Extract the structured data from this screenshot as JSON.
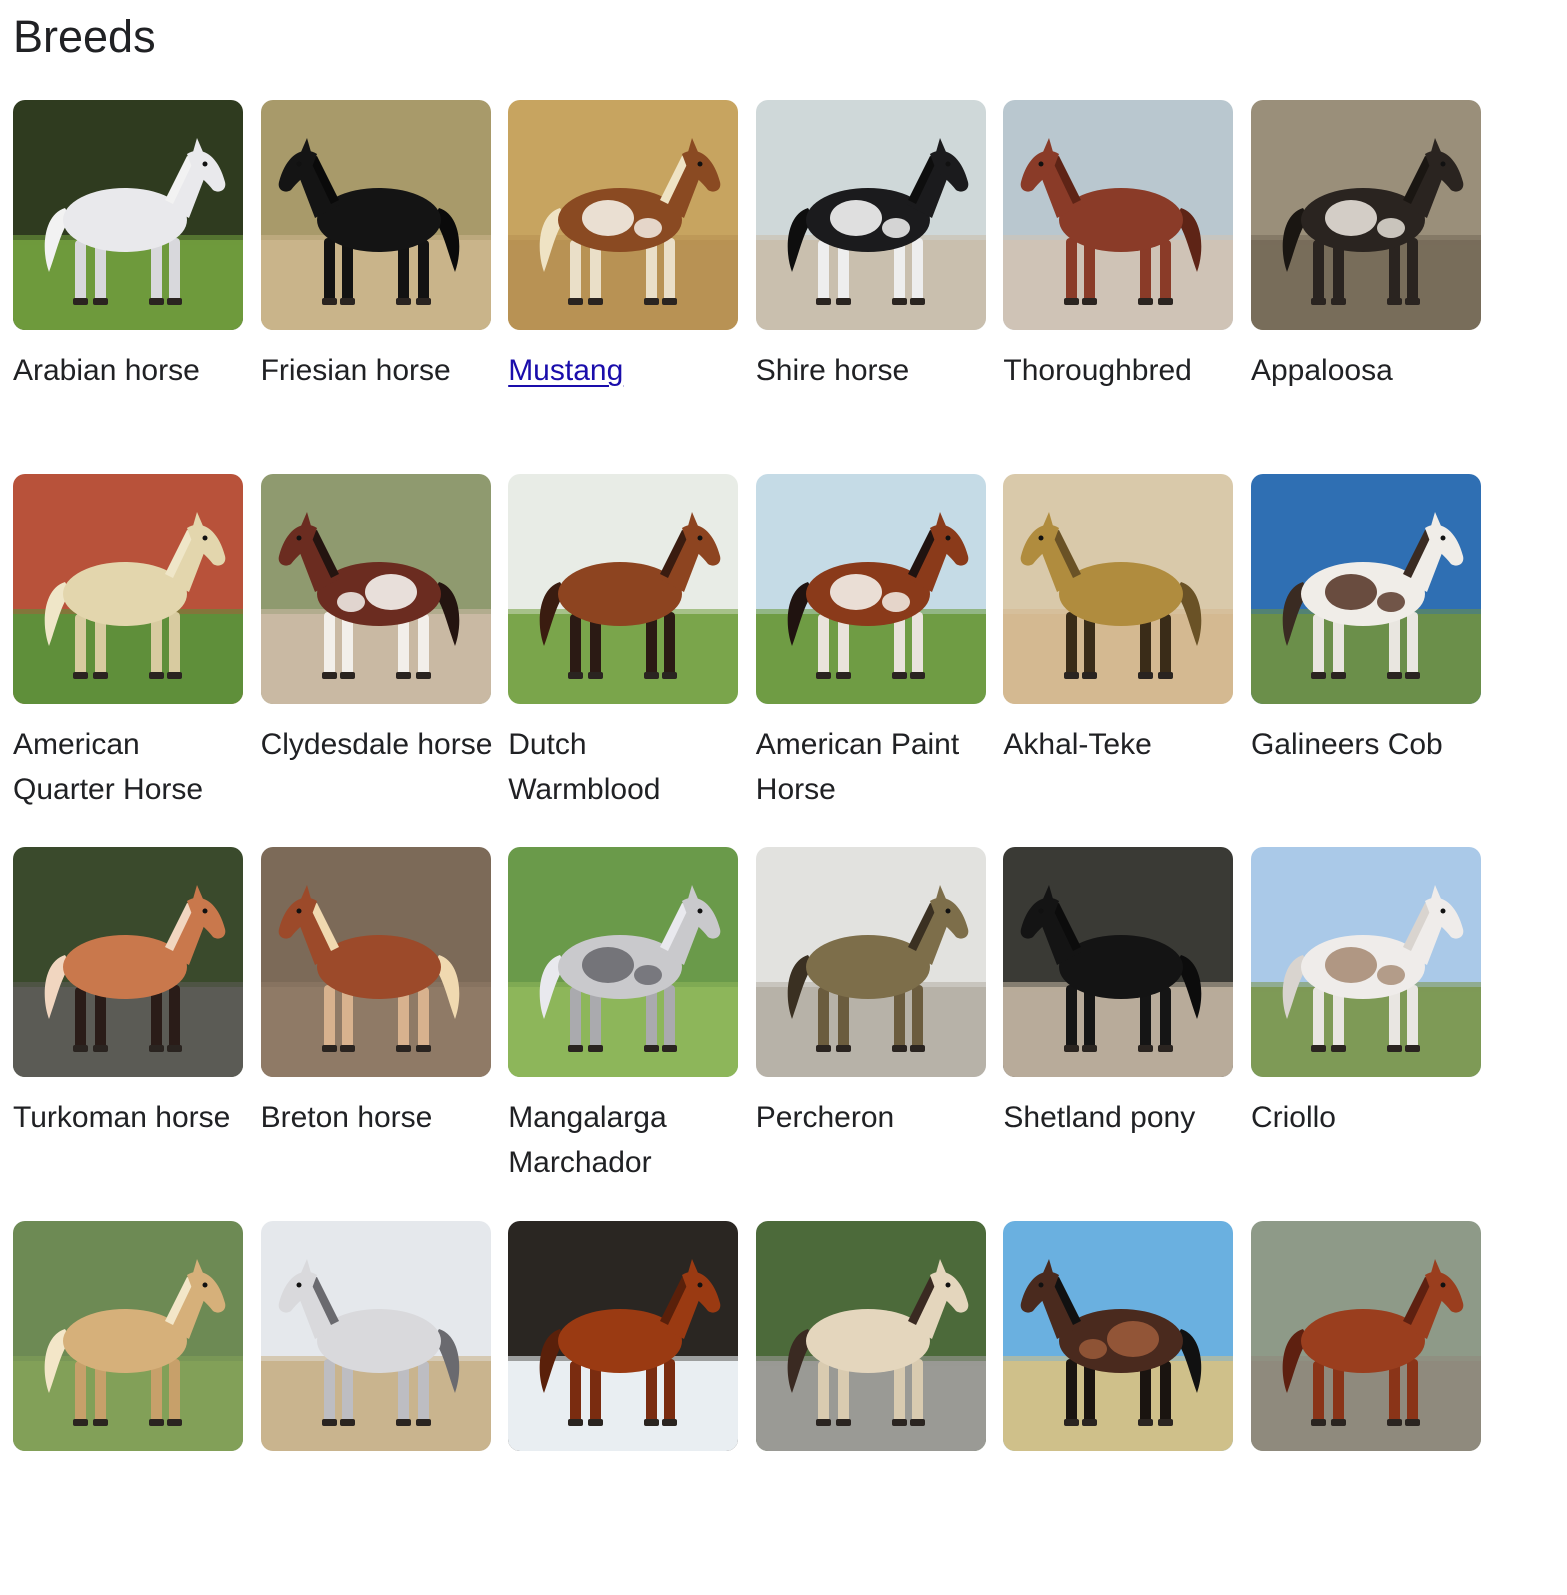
{
  "section": {
    "title": "Breeds"
  },
  "breeds": [
    {
      "name": "Arabian horse",
      "image": "horse-photo",
      "visited": false
    },
    {
      "name": "Friesian horse",
      "image": "horse-photo",
      "visited": false
    },
    {
      "name": "Mustang",
      "image": "horse-photo",
      "visited": true
    },
    {
      "name": "Shire horse",
      "image": "horse-photo",
      "visited": false
    },
    {
      "name": "Thoroughbred",
      "image": "horse-photo",
      "visited": false
    },
    {
      "name": "Appaloosa",
      "image": "horse-photo",
      "visited": false
    },
    {
      "name": "American Quarter Horse",
      "image": "horse-photo",
      "visited": false
    },
    {
      "name": "Clydesdale horse",
      "image": "horse-photo",
      "visited": false
    },
    {
      "name": "Dutch Warmblood",
      "image": "horse-photo",
      "visited": false
    },
    {
      "name": "American Paint Horse",
      "image": "horse-photo",
      "visited": false
    },
    {
      "name": "Akhal-Teke",
      "image": "horse-photo",
      "visited": false
    },
    {
      "name": "Galineers Cob",
      "image": "horse-photo",
      "visited": false
    },
    {
      "name": "Turkoman horse",
      "image": "horse-photo",
      "visited": false
    },
    {
      "name": "Breton horse",
      "image": "horse-photo",
      "visited": false
    },
    {
      "name": "Mangalarga Marchador",
      "image": "horse-photo",
      "visited": false
    },
    {
      "name": "Percheron",
      "image": "horse-photo",
      "visited": false
    },
    {
      "name": "Shetland pony",
      "image": "horse-photo",
      "visited": false
    },
    {
      "name": "Criollo",
      "image": "horse-photo",
      "visited": false
    },
    {
      "name": "",
      "image": "horse-photo",
      "visited": false
    },
    {
      "name": "",
      "image": "horse-photo",
      "visited": false
    },
    {
      "name": "",
      "image": "horse-photo",
      "visited": false
    },
    {
      "name": "",
      "image": "horse-photo",
      "visited": false
    },
    {
      "name": "",
      "image": "horse-photo",
      "visited": false
    },
    {
      "name": "",
      "image": "horse-photo",
      "visited": false
    }
  ],
  "colors": {
    "text": "#202124",
    "visited_link": "#1a0dab"
  }
}
